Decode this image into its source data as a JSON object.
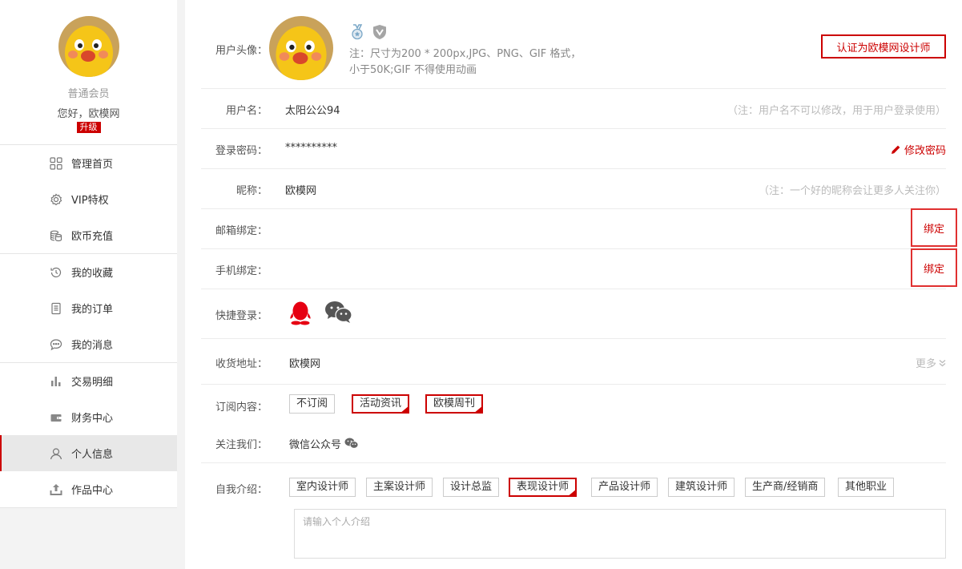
{
  "sidebar": {
    "level": "普通会员",
    "greeting": "您好，欧模网",
    "upgrade": "升级",
    "groups": [
      [
        {
          "label": "管理首页",
          "icon": "grid-icon"
        },
        {
          "label": "VIP特权",
          "icon": "gear-icon"
        },
        {
          "label": "欧币充值",
          "icon": "coins-icon"
        }
      ],
      [
        {
          "label": "我的收藏",
          "icon": "history-icon"
        },
        {
          "label": "我的订单",
          "icon": "document-icon"
        },
        {
          "label": "我的消息",
          "icon": "chat-icon"
        }
      ],
      [
        {
          "label": "交易明细",
          "icon": "bar-chart-icon"
        },
        {
          "label": "财务中心",
          "icon": "wallet-icon"
        },
        {
          "label": "个人信息",
          "icon": "user-icon",
          "active": true
        },
        {
          "label": "作品中心",
          "icon": "upload-icon"
        }
      ]
    ]
  },
  "profile": {
    "avatar_label": "用户头像：",
    "avatar_note_1": "注：尺寸为200 * 200px,JPG、PNG、GIF 格式，",
    "avatar_note_2": "小于50K;GIF 不得使用动画",
    "certify": "认证为欧模网设计师",
    "username_label": "用户名：",
    "username": "太阳公公94",
    "username_note": "（注：用户名不可以修改，用于用户登录使用）",
    "password_label": "登录密码：",
    "password": "**********",
    "change_password": "修改密码",
    "nickname_label": "昵称：",
    "nickname": "欧模网",
    "nickname_note": "（注：一个好的昵称会让更多人关注你）",
    "email_label": "邮箱绑定：",
    "email_bind": "绑定",
    "phone_label": "手机绑定：",
    "phone_bind": "绑定",
    "quick_login_label": "快捷登录：",
    "address_label": "收货地址：",
    "address": "欧模网",
    "address_more": "更多",
    "subscribe_label": "订阅内容：",
    "subscribe_options": [
      {
        "label": "不订阅",
        "selected": false
      },
      {
        "label": "活动资讯",
        "selected": true
      },
      {
        "label": "欧模周刊",
        "selected": true
      }
    ],
    "follow_label": "关注我们：",
    "follow_text": "微信公众号",
    "intro_label": "自我介绍：",
    "intro_options": [
      {
        "label": "室内设计师",
        "selected": false
      },
      {
        "label": "主案设计师",
        "selected": false
      },
      {
        "label": "设计总监",
        "selected": false
      },
      {
        "label": "表现设计师",
        "selected": true
      },
      {
        "label": "产品设计师",
        "selected": false
      },
      {
        "label": "建筑设计师",
        "selected": false
      },
      {
        "label": "生产商/经销商",
        "selected": false
      },
      {
        "label": "其他职业",
        "selected": false
      }
    ],
    "intro_placeholder": "请输入个人介绍"
  },
  "colors": {
    "accent": "#cc0000",
    "qq": "#e60012",
    "wechat": "#555555"
  }
}
